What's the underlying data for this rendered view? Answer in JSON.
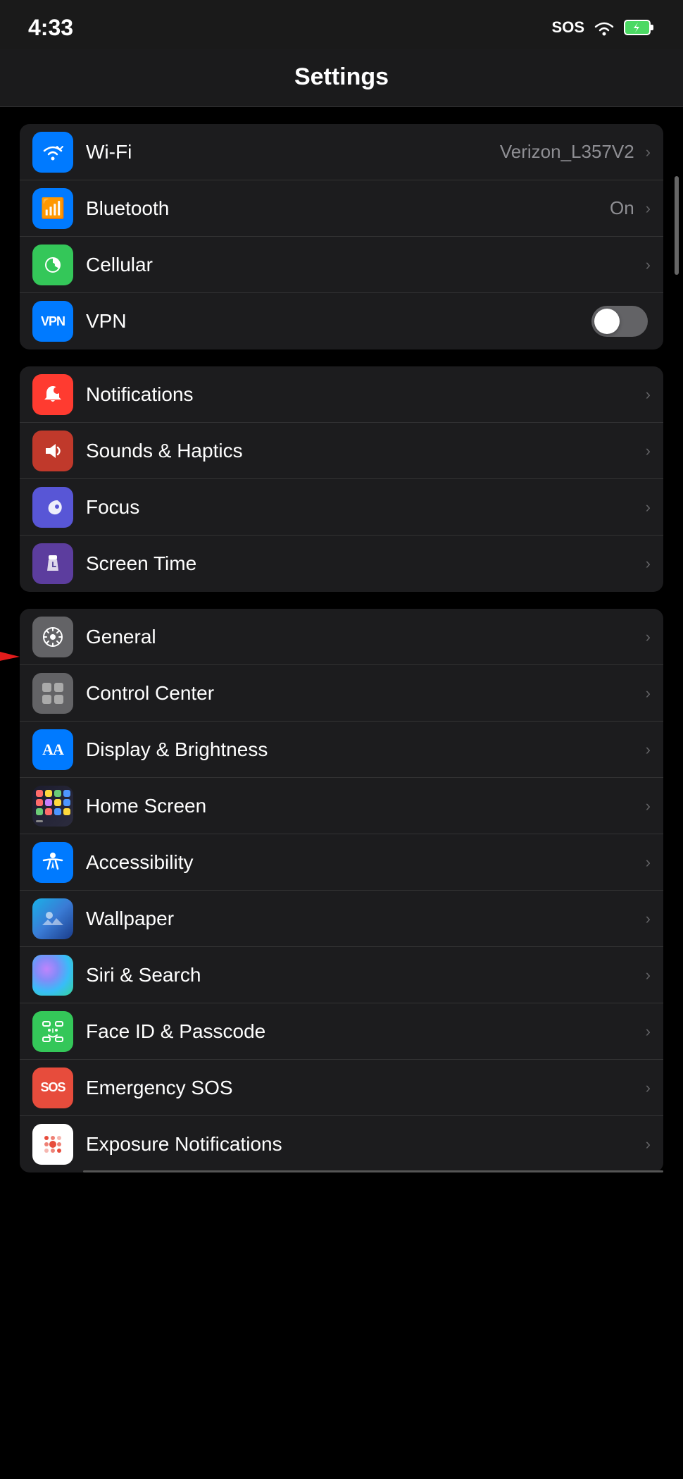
{
  "statusBar": {
    "time": "4:33",
    "sos": "SOS",
    "battery_color": "#4cd964"
  },
  "header": {
    "title": "Settings"
  },
  "sections": {
    "network": {
      "items": [
        {
          "id": "wifi",
          "label": "Wi-Fi",
          "value": "Verizon_L357V2",
          "iconBg": "icon-blue",
          "iconChar": "📶",
          "partial": true
        },
        {
          "id": "bluetooth",
          "label": "Bluetooth",
          "value": "On",
          "iconBg": "icon-blue",
          "iconChar": "B"
        },
        {
          "id": "cellular",
          "label": "Cellular",
          "value": "",
          "iconBg": "icon-green",
          "iconChar": "📡"
        },
        {
          "id": "vpn",
          "label": "VPN",
          "value": "",
          "iconBg": "icon-blue",
          "iconChar": "VPN",
          "toggle": true,
          "toggleOn": false
        }
      ]
    },
    "notifications": {
      "items": [
        {
          "id": "notifications",
          "label": "Notifications",
          "iconBg": "icon-red-orange",
          "iconChar": "🔔"
        },
        {
          "id": "sounds",
          "label": "Sounds & Haptics",
          "iconBg": "icon-dark-red",
          "iconChar": "🔊"
        },
        {
          "id": "focus",
          "label": "Focus",
          "iconBg": "icon-indigo",
          "iconChar": "🌙"
        },
        {
          "id": "screentime",
          "label": "Screen Time",
          "iconBg": "icon-dark-purple",
          "iconChar": "⏳"
        }
      ]
    },
    "general": {
      "items": [
        {
          "id": "general",
          "label": "General",
          "iconBg": "icon-gray",
          "iconChar": "⚙",
          "hasArrow": true
        },
        {
          "id": "controlcenter",
          "label": "Control Center",
          "iconBg": "icon-gray",
          "iconChar": "⊞"
        },
        {
          "id": "displaybrightness",
          "label": "Display & Brightness",
          "iconBg": "icon-blue-aa",
          "iconChar": "AA"
        },
        {
          "id": "homescreen",
          "label": "Home Screen",
          "iconBg": "home-screen",
          "iconChar": "grid"
        },
        {
          "id": "accessibility",
          "label": "Accessibility",
          "iconBg": "icon-blue",
          "iconChar": "♿"
        },
        {
          "id": "wallpaper",
          "label": "Wallpaper",
          "iconBg": "wallpaper",
          "iconChar": "✿"
        },
        {
          "id": "siri",
          "label": "Siri & Search",
          "iconBg": "siri",
          "iconChar": "◉"
        },
        {
          "id": "faceid",
          "label": "Face ID & Passcode",
          "iconBg": "icon-green-face",
          "iconChar": "😊"
        },
        {
          "id": "emergencysos",
          "label": "Emergency SOS",
          "iconBg": "icon-sos-red",
          "iconChar": "SOS"
        },
        {
          "id": "exposure",
          "label": "Exposure Notifications",
          "iconBg": "exposure",
          "iconChar": "◉",
          "partial_bottom": true
        }
      ]
    }
  },
  "arrow": {
    "label": "red arrow pointing to General"
  }
}
